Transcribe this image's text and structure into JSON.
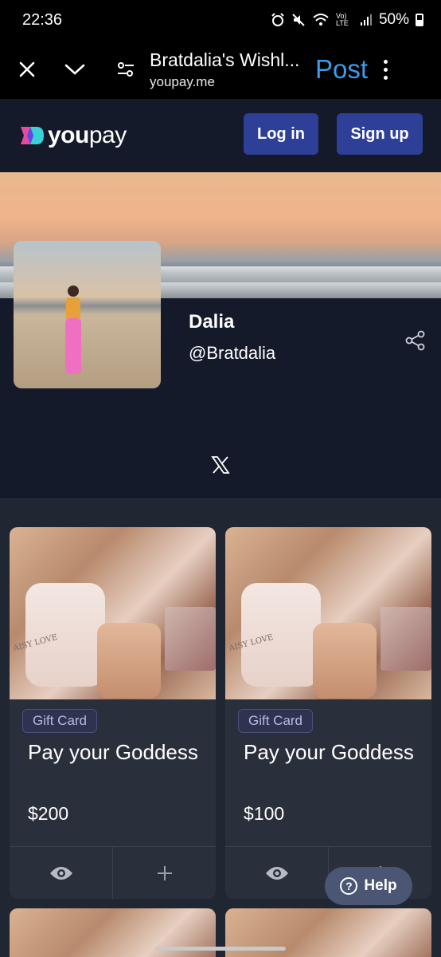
{
  "status": {
    "time": "22:36",
    "battery": "50%",
    "net": "Vo) LTE"
  },
  "browser": {
    "title": "Bratdalia's Wishl...",
    "url": "youpay.me",
    "action": "Post"
  },
  "site": {
    "logo_bold": "you",
    "logo_light": "pay",
    "login_label": "Log in",
    "signup_label": "Sign up"
  },
  "profile": {
    "name": "Dalia",
    "handle": "@Bratdalia"
  },
  "products": [
    {
      "badge": "Gift Card",
      "title": "Pay your Goddess",
      "price": "$200",
      "image_text": "AISY LOVE"
    },
    {
      "badge": "Gift Card",
      "title": "Pay your Goddess",
      "price": "$100",
      "image_text": "AISY LOVE"
    }
  ],
  "help": {
    "label": "Help"
  },
  "colors": {
    "accent": "#2e3f98",
    "post": "#3d9be9",
    "header_bg": "#141a2a",
    "grid_bg": "#212633"
  }
}
